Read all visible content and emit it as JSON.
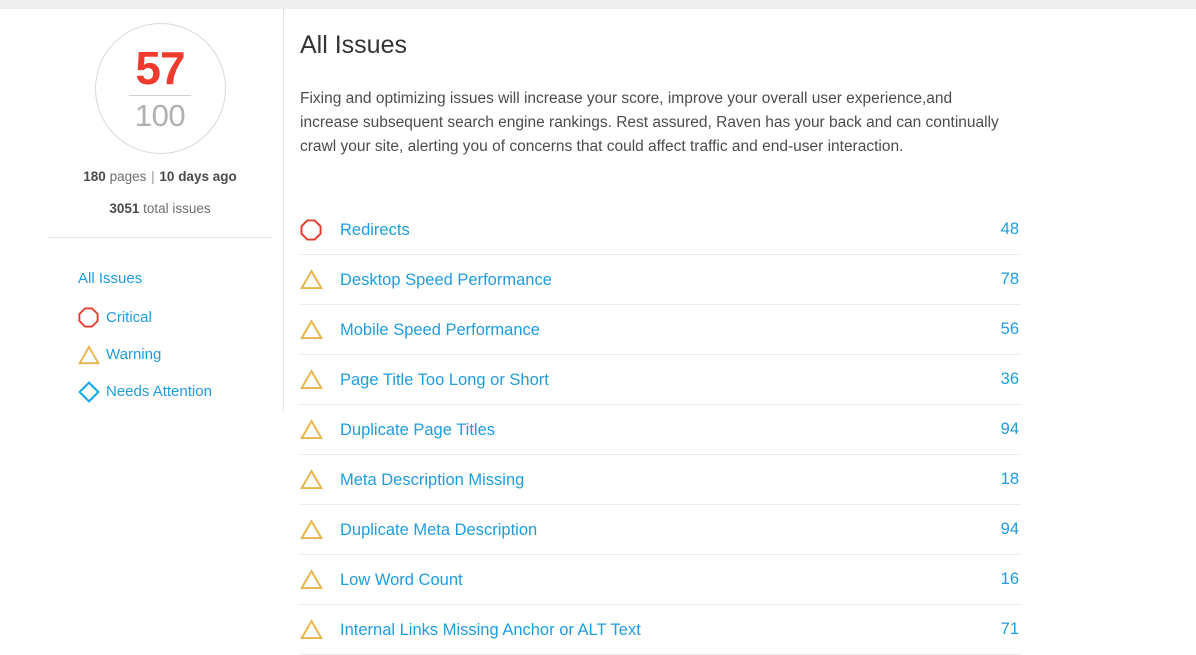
{
  "sidebar": {
    "score": {
      "value": "57",
      "max": "100",
      "value_color": "#ef3b2d",
      "max_color": "#b0b0b0"
    },
    "meta": {
      "pages_count": "180",
      "pages_label": "pages",
      "separator": "|",
      "crawl_age": "10 days ago",
      "total_issues_count": "3051",
      "total_issues_label": "total issues"
    },
    "nav": [
      {
        "label": "All Issues",
        "icon": "none"
      },
      {
        "label": "Critical",
        "icon": "octagon-icon",
        "icon_color": "#e8392b"
      },
      {
        "label": "Warning",
        "icon": "triangle-icon",
        "icon_color": "#e8b348"
      },
      {
        "label": "Needs Attention",
        "icon": "diamond-icon",
        "icon_color": "#00a6e2"
      }
    ]
  },
  "main": {
    "title": "All Issues",
    "intro": "Fixing and optimizing issues will increase your score, improve your overall user experience,and increase subsequent search engine rankings. Rest assured, Raven has your back and can continually crawl your site, alerting you of concerns that could affect traffic and end-user interaction.",
    "issues": [
      {
        "label": "Redirects",
        "count": "48",
        "severity": "critical",
        "icon": "octagon-icon"
      },
      {
        "label": "Desktop Speed Performance",
        "count": "78",
        "severity": "warning",
        "icon": "triangle-icon"
      },
      {
        "label": "Mobile Speed Performance",
        "count": "56",
        "severity": "warning",
        "icon": "triangle-icon"
      },
      {
        "label": "Page Title Too Long or Short",
        "count": "36",
        "severity": "warning",
        "icon": "triangle-icon"
      },
      {
        "label": "Duplicate Page Titles",
        "count": "94",
        "severity": "warning",
        "icon": "triangle-icon"
      },
      {
        "label": "Meta Description Missing",
        "count": "18",
        "severity": "warning",
        "icon": "triangle-icon"
      },
      {
        "label": "Duplicate Meta Description",
        "count": "94",
        "severity": "warning",
        "icon": "triangle-icon"
      },
      {
        "label": "Low Word Count",
        "count": "16",
        "severity": "warning",
        "icon": "triangle-icon"
      },
      {
        "label": "Internal Links Missing Anchor or ALT Text",
        "count": "71",
        "severity": "warning",
        "icon": "triangle-icon"
      }
    ]
  },
  "colors": {
    "link": "#1f9ce0",
    "critical": "#e8392b",
    "warning": "#e8b348",
    "attention": "#00a6e2",
    "score": "#ef3b2d",
    "topbar": "#eeeeee"
  }
}
